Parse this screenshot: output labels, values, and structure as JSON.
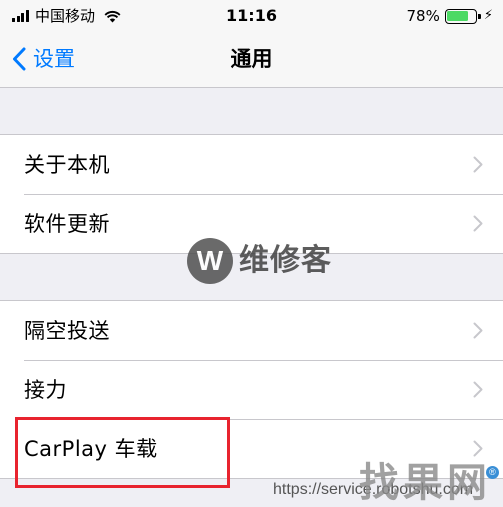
{
  "status_bar": {
    "carrier": "中国移动",
    "time": "11:16",
    "battery_percent": "78%",
    "battery_level": 0.78,
    "battery_color": "#4cd964"
  },
  "nav": {
    "back_label": "设置",
    "title": "通用",
    "accent_color": "#007aff"
  },
  "groups": [
    {
      "rows": [
        {
          "label": "关于本机"
        },
        {
          "label": "软件更新"
        }
      ]
    },
    {
      "rows": [
        {
          "label": "隔空投送"
        },
        {
          "label": "接力"
        },
        {
          "label": "CarPlay 车载"
        }
      ]
    }
  ],
  "highlight_color": "#e8232e",
  "watermarks": {
    "logo_letter": "W",
    "brand": "维修客",
    "url": "https://service.robotshu.com",
    "site": "找果网",
    "reg": "®"
  }
}
